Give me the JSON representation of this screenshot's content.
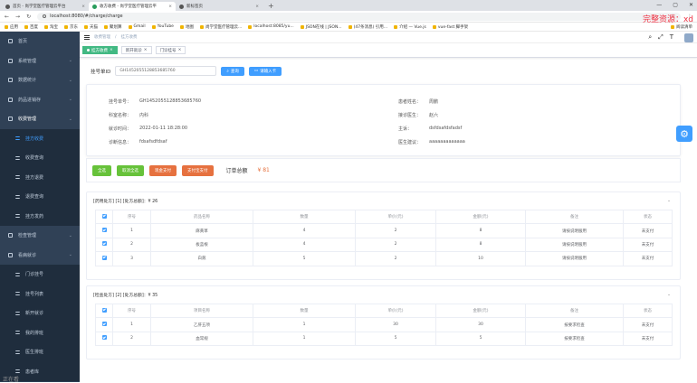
{
  "browser": {
    "tabs": [
      {
        "title": "首页 - 尚学堂医疗管理云平台",
        "active": false
      },
      {
        "title": "收方收费 - 尚学堂医疗管理云平",
        "active": true
      },
      {
        "title": "新标签页",
        "active": false
      }
    ],
    "url": "localhost:8080/#/charge/charge",
    "bookmarks": [
      "应用",
      "百度",
      "淘宝",
      "京东",
      "天猫",
      "聚划算",
      "Gmail",
      "YouTube",
      "地图",
      "尚学堂医疗管理云...",
      "localhost:8085/yu...",
      "JSON在线 | JSON...",
      "(47条消息) 引用...",
      "介绍 — Vue.js",
      "vue-fast 脚手架",
      "阅读清单"
    ]
  },
  "overlay_text": "完整资源：xd",
  "sidebar": {
    "items": [
      {
        "label": "首页",
        "arrow": false,
        "sub": false,
        "state": "normal"
      },
      {
        "label": "系统管理",
        "arrow": true,
        "sub": false,
        "state": "normal"
      },
      {
        "label": "数据统计",
        "arrow": true,
        "sub": false,
        "state": "normal"
      },
      {
        "label": "药品进销存",
        "arrow": true,
        "sub": false,
        "state": "normal"
      },
      {
        "label": "收费管理",
        "arrow": true,
        "sub": false,
        "state": "highlight"
      },
      {
        "label": "挂方收费",
        "arrow": false,
        "sub": true,
        "state": "active"
      },
      {
        "label": "收费查询",
        "arrow": false,
        "sub": true,
        "state": "normal"
      },
      {
        "label": "挂方退费",
        "arrow": false,
        "sub": true,
        "state": "normal"
      },
      {
        "label": "退费查询",
        "arrow": false,
        "sub": true,
        "state": "normal"
      },
      {
        "label": "挂方发药",
        "arrow": false,
        "sub": true,
        "state": "normal"
      },
      {
        "label": "检查管理",
        "arrow": true,
        "sub": false,
        "state": "normal"
      },
      {
        "label": "看病就诊",
        "arrow": true,
        "sub": false,
        "state": "normal"
      },
      {
        "label": "门诊挂号",
        "arrow": false,
        "sub": true,
        "state": "normal"
      },
      {
        "label": "挂号列表",
        "arrow": false,
        "sub": true,
        "state": "normal"
      },
      {
        "label": "新开就诊",
        "arrow": false,
        "sub": true,
        "state": "normal"
      },
      {
        "label": "我的排班",
        "arrow": false,
        "sub": true,
        "state": "normal"
      },
      {
        "label": "医生排班",
        "arrow": false,
        "sub": true,
        "state": "normal"
      },
      {
        "label": "患者库",
        "arrow": false,
        "sub": true,
        "state": "normal"
      }
    ]
  },
  "header": {
    "breadcrumb": [
      "收费管理",
      "挂方收费"
    ]
  },
  "page_tabs": [
    {
      "label": "挂方收费",
      "active": true
    },
    {
      "label": "新开就诊",
      "active": false
    },
    {
      "label": "门诊挂号",
      "active": false
    }
  ],
  "search": {
    "label": "挂号单ID",
    "value": "GH1452055128853685760",
    "query_button": "查询",
    "card_button": "请输入卡"
  },
  "info": {
    "reg_id_label": "挂号单号：",
    "reg_id": "GH1452055128853685760",
    "patient_name_label": "患者姓名：",
    "patient_name": "周鹏",
    "dept_label": "科室名称：",
    "dept": "内科",
    "doctor_label": "接诊医生：",
    "doctor": "赵六",
    "visit_time_label": "就诊时间：",
    "visit_time": "2022-01-11 18:28:00",
    "complaint_label": "主诉：",
    "complaint": "dsfdsafdsfadsf",
    "diagnosis_label": "诊断信息：",
    "diagnosis": "fdsafsdfdsaf",
    "advice_label": "医生建议：",
    "advice": "aaaaaaaaaaaaa"
  },
  "actions": {
    "select_all": "全选",
    "deselect_all": "取消全选",
    "cash_pay": "现金支付",
    "alipay": "支付宝支付",
    "total_label": "订单总额",
    "total_value": "¥ 81"
  },
  "prescriptions": [
    {
      "header": "[药用处方]  [1]  [处方总额]：¥ 26",
      "columns": [
        "",
        "序号",
        "药品名称",
        "数量",
        "单价(元)",
        "金额(元)",
        "备注",
        "状态"
      ],
      "rows": [
        [
          "1",
          "麻黄草",
          "4",
          "2",
          "8",
          "请按说明服用",
          "未支付"
        ],
        [
          "2",
          "板蓝根",
          "4",
          "2",
          "8",
          "请按说明服用",
          "未支付"
        ],
        [
          "3",
          "白蔹",
          "5",
          "2",
          "10",
          "请按说明服用",
          "未支付"
        ]
      ]
    },
    {
      "header": "[检查处方]  [2]  [处方总额]：¥ 35",
      "columns": [
        "",
        "序号",
        "项目名称",
        "数量",
        "单价(元)",
        "金额(元)",
        "备注",
        "状态"
      ],
      "rows": [
        [
          "1",
          "乙肝五项",
          "1",
          "30",
          "30",
          "按要求检查",
          "未支付"
        ],
        [
          "2",
          "血常规",
          "1",
          "5",
          "5",
          "按要求检查",
          "未支付"
        ]
      ]
    }
  ],
  "watermark": "正在看"
}
